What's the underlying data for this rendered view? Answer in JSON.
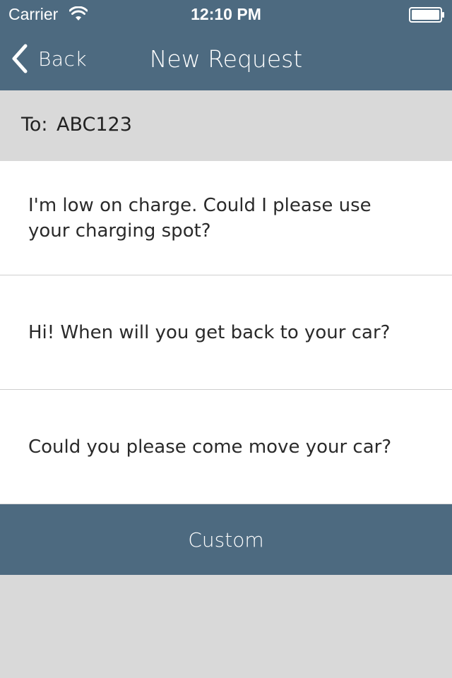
{
  "status_bar": {
    "carrier": "Carrier",
    "time": "12:10 PM",
    "wifi_icon": "wifi-icon",
    "battery_icon": "battery-icon"
  },
  "nav": {
    "back_label": "Back",
    "back_icon": "chevron-left-icon",
    "title": "New Request"
  },
  "recipient": {
    "label": "To:",
    "value": "ABC123"
  },
  "messages": [
    {
      "text": "I'm low on charge. Could I please use your charging spot?"
    },
    {
      "text": "Hi! When will you get back to your car?"
    },
    {
      "text": "Could you please come move your car?"
    }
  ],
  "custom_button": {
    "label": "Custom"
  },
  "colors": {
    "header_bg": "#4d6a80",
    "body_bg": "#d9d9d9",
    "row_bg": "#ffffff"
  }
}
